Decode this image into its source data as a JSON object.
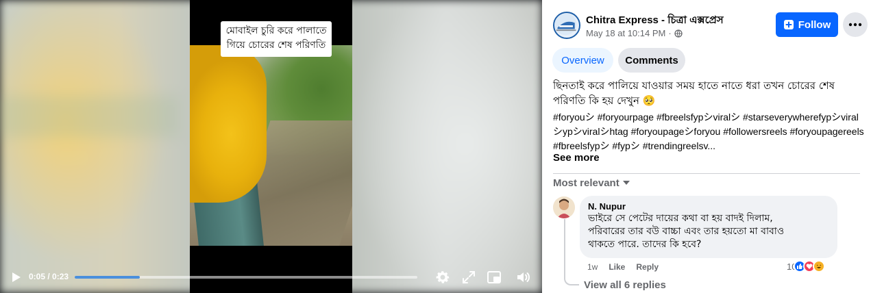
{
  "video": {
    "overlay_caption_line1": "মোবাইল চুরি করে পালাতে",
    "overlay_caption_line2": "গিয়ে চোরের শেষ পরিণতি",
    "current_time": "0:05",
    "duration": "0:23",
    "time_display": "0:05 / 0:23",
    "progress_fraction": 0.19,
    "accent_color": "#4a8fdd"
  },
  "post": {
    "page_name": "Chitra Express - চিত্রা এক্সপ্রেস",
    "date": "May 18 at 10:14 PM",
    "separator": "·",
    "audience_icon": "globe-icon",
    "follow_label": "Follow",
    "follow_color": "#0866ff",
    "more_icon": "ellipsis-icon",
    "tabs": [
      {
        "label": "Overview",
        "active": true
      },
      {
        "label": "Comments",
        "active": false
      }
    ],
    "description": "ছিনতাই করে পালিয়ে যাওয়ার সময় হাতে নাতে ধরা তখন চোরের শেষ পরিণতি কি হয় দেখুন 🥺",
    "hashtags": "#foryouシ #foryourpage #fbreelsfypシviralシ #starseverywherefypシviralシypシviralシhtag #foryoupageシforyou #followersreels #foryoupagereels #fbreelsfypシ #fypシ #trendingreelsv...",
    "see_more": "See more",
    "sort_label": "Most relevant"
  },
  "comment": {
    "author": "N. Nupur",
    "text_line1": "ভাইরে সে পেটের দায়ের কথা বা হয় বাদই দিলাম,",
    "text_line2": "পরিবারের তার বউ বাচ্চা এবং তার হয়তো মা বাবাও",
    "text_line3": "থাকতে পারে. তাদের কি হবে?",
    "time": "1w",
    "like_label": "Like",
    "reply_label": "Reply",
    "reaction_count": "10",
    "reactions": [
      "like",
      "love",
      "haha"
    ],
    "view_replies": "View all 6 replies"
  }
}
